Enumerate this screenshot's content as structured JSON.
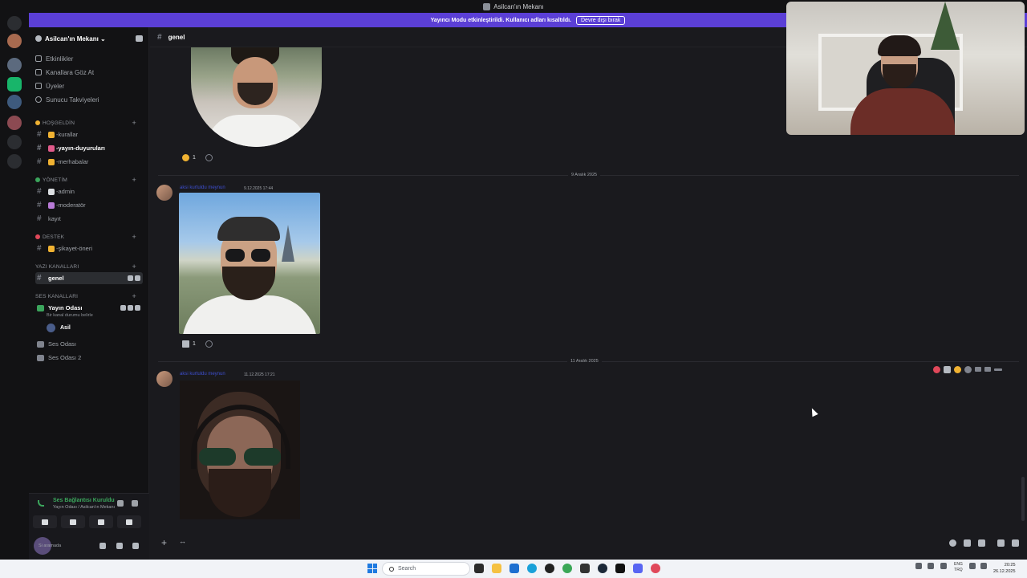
{
  "window": {
    "title": "Asilcan'ın Mekanı"
  },
  "banner": {
    "text": "Yayıncı Modu etkinleştirildi. Kullanıcı adları kısaltıldı.",
    "button": "Devre dışı bırak"
  },
  "server": {
    "name": "Asilcan'ın Mekanı ⌄"
  },
  "nav": [
    "Etkinlikler",
    "Kanallara Göz At",
    "Üyeler",
    "Sunucu Takviyeleri"
  ],
  "categories": {
    "welcome": {
      "label": "HOŞGELDİN",
      "channels": [
        "-kurallar",
        "-yayın-duyuruları",
        "-merhabalar"
      ]
    },
    "admin": {
      "label": "YÖNETİM",
      "channels": [
        "-admin",
        "-moderatör",
        "kayıt"
      ]
    },
    "support": {
      "label": "DESTEK",
      "channels": [
        "-şikayet-öneri"
      ]
    },
    "text": {
      "label": "YAZI KANALLARI",
      "channels": [
        "genel"
      ]
    },
    "voice": {
      "label": "SES KANALLARI",
      "channels": [
        "Yayın Odası",
        "Ses Odası",
        "Ses Odası 2"
      ],
      "status_hint": "Bir kanal durumu belirle",
      "user": "Asil"
    }
  },
  "voice_panel": {
    "title": "Ses Bağlantısı Kuruldu",
    "subtitle": "Yayın Odası / Asilcan'ın Mekanı",
    "user_status": "Si aramada"
  },
  "channel": {
    "name": "genel"
  },
  "messages": [
    {
      "reaction_count": "1"
    },
    {
      "date": "9 Aralık 2025",
      "author": "aksi kurtuldu meynun",
      "time": "9.12.2025 17:44",
      "reaction_count": "1"
    },
    {
      "date": "11 Aralık 2025",
      "author": "aksi kurtuldu meynun",
      "time": "11.12.2025 17:21"
    }
  ],
  "taskbar": {
    "search_placeholder": "Search",
    "lang_top": "ENG",
    "lang_bottom": "TRQ",
    "time": "20:25",
    "date": "26.12.2025"
  },
  "colors": {
    "accent": "#5b3fd6",
    "voice_green": "#3ba55c",
    "bg": "#1a1a1e",
    "sidebar": "#121214"
  }
}
